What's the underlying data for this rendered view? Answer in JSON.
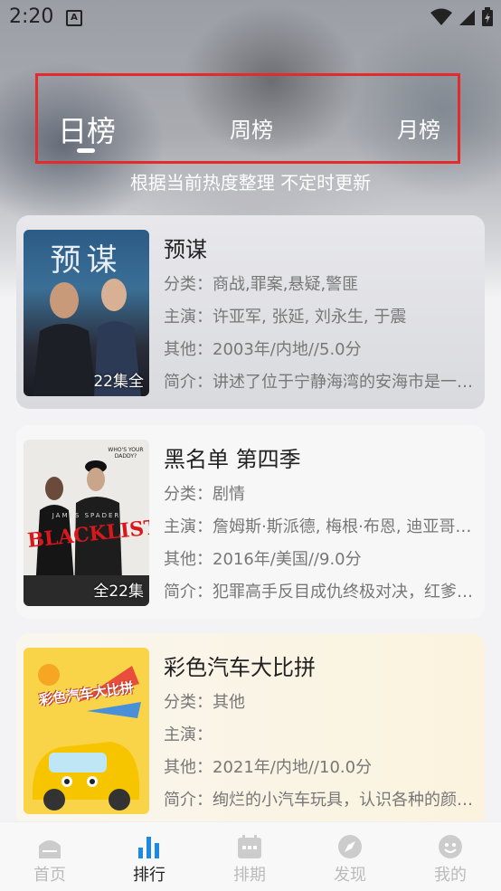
{
  "status_bar": {
    "time": "2:20",
    "notification_icon": "A"
  },
  "ranking_tabs": [
    {
      "label": "日榜",
      "active": true
    },
    {
      "label": "周榜",
      "active": false
    },
    {
      "label": "月榜",
      "active": false
    }
  ],
  "subtitle": "根据当前热度整理 不定时更新",
  "items": [
    {
      "title": "预谋",
      "badge": "22集全",
      "category": "分类：商战,罪案,悬疑,警匪",
      "cast": "主演：许亚军, 张延, 刘永生, 于震",
      "other": "其他：2003年/内地//5.0分",
      "intro": "简介：讲述了位于宁静海湾的安海市是一座美丽的城市",
      "poster_text": "预谋"
    },
    {
      "title": "黑名单 第四季",
      "badge": "全22集",
      "category": "分类：剧情",
      "cast": "主演：詹姆斯·斯派德, 梅根·布恩, 迪亚哥·克拉特霍夫",
      "other": "其他：2016年/美国//9.0分",
      "intro": "简介：犯罪高手反目成仇终极对决，红爹遭遇危机",
      "poster_text": "BLACKLIST",
      "poster_subtext": "JAMES SPADER",
      "poster_tag": "WHO'S YOUR DADDY?"
    },
    {
      "title": "彩色汽车大比拼",
      "badge": "",
      "category": "分类：其他",
      "cast": "主演：",
      "other": "其他：2021年/内地//10.0分",
      "intro": "简介：绚烂的小汽车玩具，认识各种的颜色和形状",
      "poster_text": "彩色汽车大比拼"
    }
  ],
  "bottom_nav": [
    {
      "label": "首页",
      "icon": "home-icon",
      "active": false
    },
    {
      "label": "排行",
      "icon": "bar-chart-icon",
      "active": true
    },
    {
      "label": "排期",
      "icon": "calendar-icon",
      "active": false
    },
    {
      "label": "发现",
      "icon": "compass-icon",
      "active": false
    },
    {
      "label": "我的",
      "icon": "profile-icon",
      "active": false
    }
  ],
  "colors": {
    "accent": "#1e88e5",
    "highlight_border": "#e42a2a",
    "inactive_nav": "#bbbbbb"
  }
}
